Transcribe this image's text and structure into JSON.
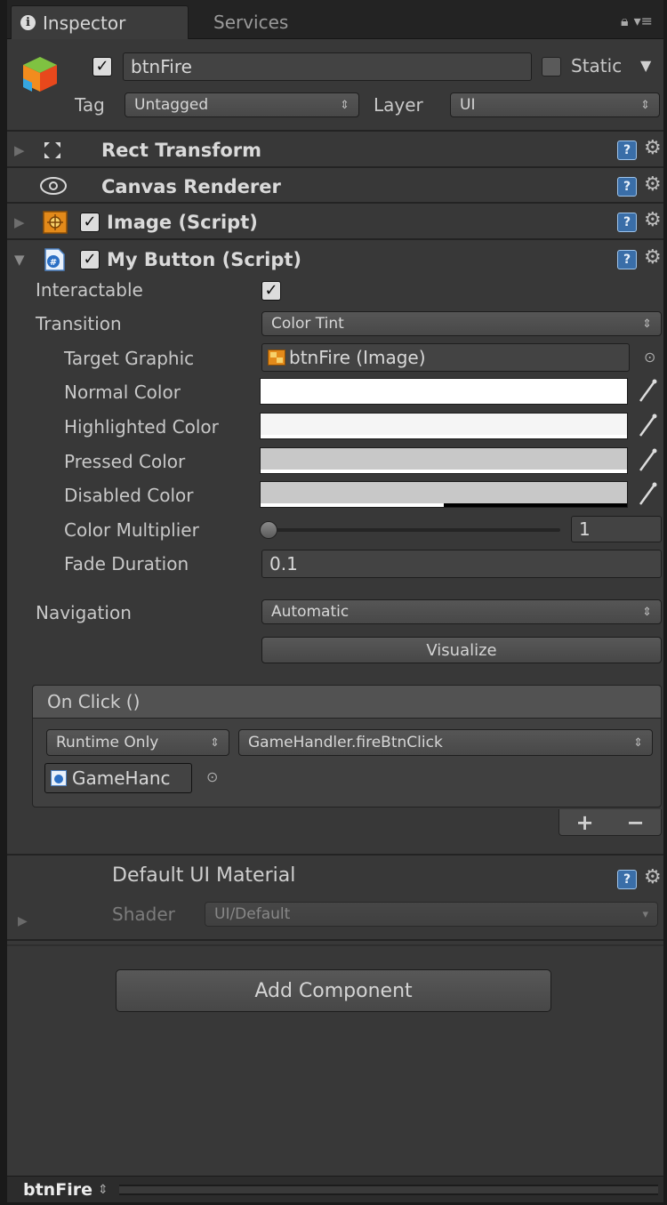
{
  "tabs": [
    {
      "label": "Inspector",
      "active": true
    },
    {
      "label": "Services",
      "active": false
    }
  ],
  "icons": {
    "tab_info": "info-icon",
    "lock": "lock-icon",
    "menu": "menu-icon",
    "object": "gameobject-cube-icon",
    "help": "help-icon",
    "settings": "gear-icon",
    "object_picker": "object-picker-icon",
    "color_picker": "eyedropper-icon"
  },
  "header": {
    "active": true,
    "object_name": "btnFire",
    "static_label": "Static",
    "static": false,
    "tag_label": "Tag",
    "tag_value": "Untagged",
    "layer_label": "Layer",
    "layer_value": "UI"
  },
  "components": {
    "rect_transform": {
      "title": "Rect Transform"
    },
    "canvas_renderer": {
      "title": "Canvas Renderer"
    },
    "image": {
      "title": "Image (Script)",
      "enabled": true
    },
    "my_button": {
      "title": "My Button (Script)",
      "enabled": true
    }
  },
  "my_button": {
    "interactable": {
      "label": "Interactable",
      "value": true
    },
    "transition": {
      "label": "Transition",
      "value": "Color Tint"
    },
    "target_graphic": {
      "label": "Target Graphic",
      "value": "btnFire (Image)"
    },
    "normal_color": {
      "label": "Normal Color",
      "color": "#FFFFFF",
      "alpha": 1.0
    },
    "highlighted_color": {
      "label": "Highlighted Color",
      "color": "#F5F5F5",
      "alpha": 1.0
    },
    "pressed_color": {
      "label": "Pressed Color",
      "color": "#C8C8C8",
      "alpha": 1.0
    },
    "disabled_color": {
      "label": "Disabled Color",
      "color": "#C8C8C8",
      "alpha": 0.5
    },
    "color_multiplier": {
      "label": "Color Multiplier",
      "value": "1",
      "slider_fraction": 0.0
    },
    "fade_duration": {
      "label": "Fade Duration",
      "value": "0.1"
    },
    "navigation": {
      "label": "Navigation",
      "value": "Automatic"
    },
    "visualize_label": "Visualize",
    "on_click": {
      "title": "On Click ()",
      "runtime": "Runtime Only",
      "function": "GameHandler.fireBtnClick",
      "target_object": "GameHanc",
      "add_label": "+",
      "remove_label": "−"
    }
  },
  "material": {
    "name": "Default UI Material",
    "shader_label": "Shader",
    "shader_value": "UI/Default"
  },
  "add_component_label": "Add Component",
  "footer": {
    "object_name": "btnFire"
  }
}
